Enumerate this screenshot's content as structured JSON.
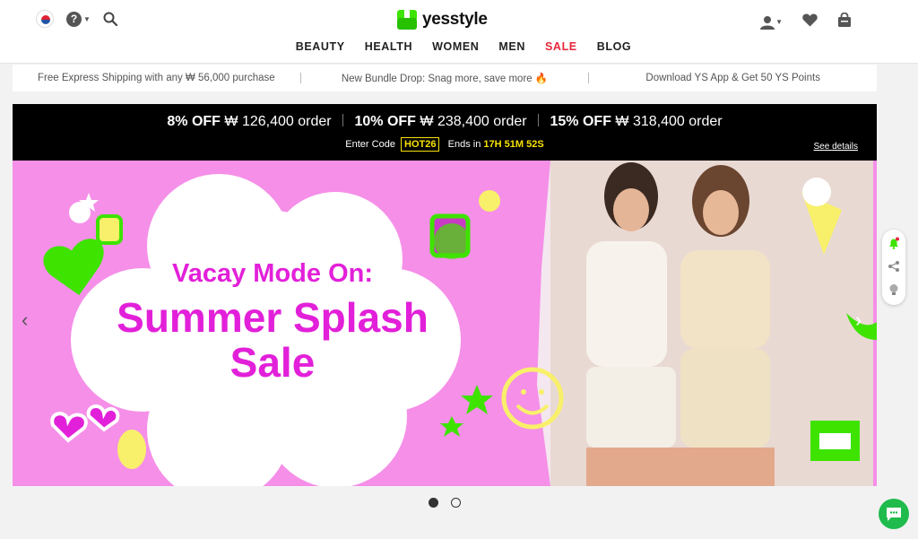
{
  "header": {
    "logo_text": "yesstyle",
    "nav": [
      {
        "label": "BEAUTY"
      },
      {
        "label": "HEALTH"
      },
      {
        "label": "WOMEN"
      },
      {
        "label": "MEN"
      },
      {
        "label": "SALE",
        "color": "#e8263a"
      },
      {
        "label": "BLOG"
      }
    ],
    "icons_left": [
      "korea-flag-icon",
      "help-icon",
      "search-icon"
    ],
    "icons_right": [
      "user-icon",
      "heart-icon",
      "bag-icon"
    ]
  },
  "promo_strip": {
    "items": [
      "Free Express Shipping with any ₩ 56,000 purchase",
      "New Bundle Drop: Snag more, save more",
      "Download YS App & Get 50 YS Points"
    ]
  },
  "offer_banner": {
    "offers": [
      {
        "pct": "8% OFF",
        "amount": "₩ 126,400 order"
      },
      {
        "pct": "10% OFF",
        "amount": "₩ 238,400 order"
      },
      {
        "pct": "15% OFF",
        "amount": "₩ 318,400 order"
      }
    ],
    "enter_code_label": "Enter Code",
    "code": "HOT26",
    "ends_label": "Ends in",
    "timer": "17H 51M 52S",
    "details_link": "See details"
  },
  "hero": {
    "line1": "Vacay Mode On:",
    "line2": "Summer Splash",
    "line3": "Sale",
    "bg_color": "#f58fe8",
    "text_color": "#e220d9",
    "accent_color": "#3ee300"
  },
  "carousel": {
    "slides": 2,
    "active": 1
  }
}
